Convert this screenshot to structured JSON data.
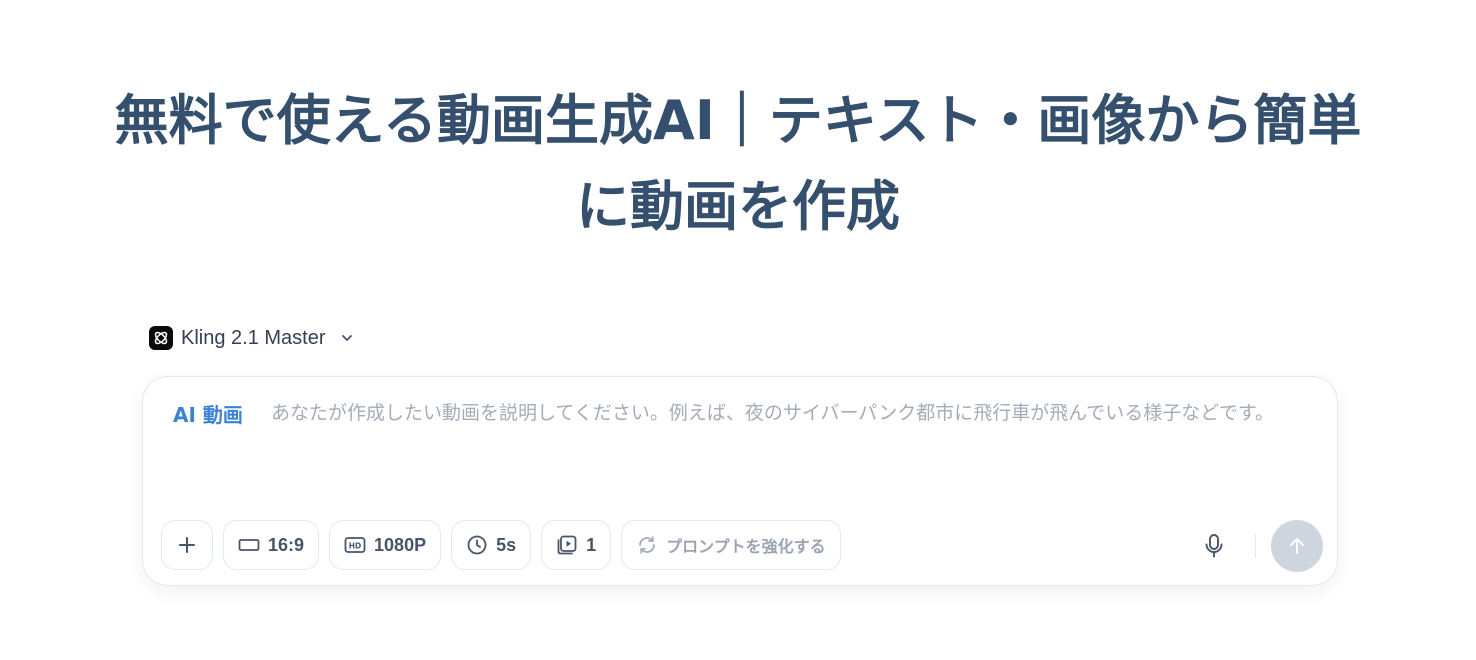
{
  "hero": {
    "title": "無料で使える動画生成AI｜テキスト・画像から簡単に動画を作成"
  },
  "model_selector": {
    "label": "Kling 2.1 Master",
    "icon": "kling-logo-icon"
  },
  "composer": {
    "mode_label": "AI 動画",
    "placeholder": "あなたが作成したい動画を説明してください。例えば、夜のサイバーパンク都市に飛行車が飛んでいる様子などです。",
    "value": "",
    "toolbar": {
      "add_icon": "plus-icon",
      "aspect_ratio": "16:9",
      "resolution": "1080P",
      "duration": "5s",
      "count": "1",
      "enhance_label": "プロンプトを強化する",
      "mic_icon": "microphone-icon",
      "send_icon": "arrow-up-icon"
    }
  },
  "colors": {
    "title": "#35506e",
    "accent": "#3b82d6",
    "placeholder": "#a3acb9",
    "send_disabled": "#cdd5df",
    "border": "#e2e8f0"
  }
}
